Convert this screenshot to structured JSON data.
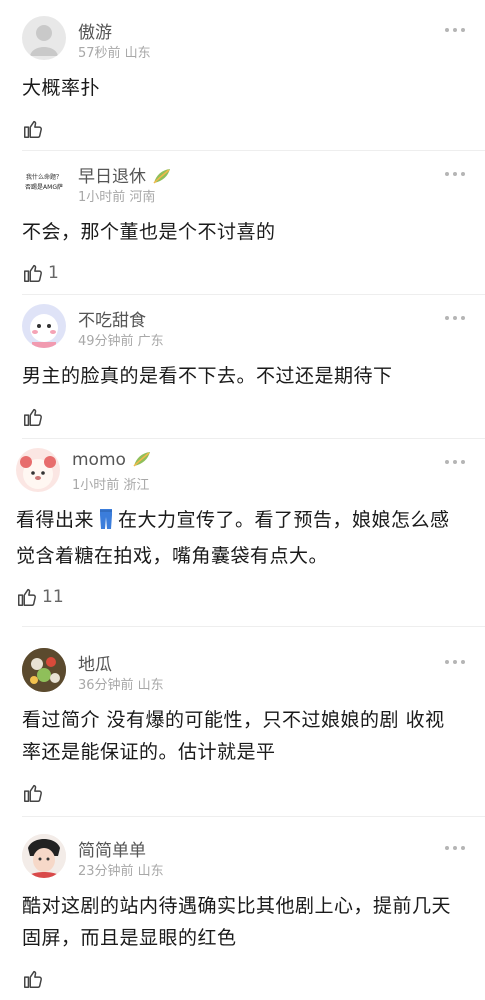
{
  "comments": [
    {
      "username": "傲游",
      "meta": "57秒前 山东",
      "text": "大概率扑",
      "likes": "",
      "badge": false,
      "avatar": "default-avatar"
    },
    {
      "username": "早日退休",
      "meta": "1小时前 河南",
      "text": "不会，那个董也是个不讨喜的",
      "likes": "1",
      "badge": true,
      "avatar": "text-avatar",
      "avatar_text_1": "我什么命题？",
      "avatar_text_2": "否踢是AMG萨"
    },
    {
      "username": "不吃甜食",
      "meta": "49分钟前 广东",
      "text": "男主的脸真的是看不下去。不过还是期待下",
      "likes": "",
      "badge": false,
      "avatar": "cartoon-avatar"
    },
    {
      "username": "momo",
      "meta": "1小时前 浙江",
      "text_before": "看得出来",
      "text_after": "在大力宣传了。看了预告，娘娘怎么感觉含着糖在拍戏，嘴角囊袋有点大。",
      "likes": "11",
      "badge": true,
      "avatar": "bear-avatar",
      "inline_icon": "jeans-emoji"
    },
    {
      "username": "地瓜",
      "meta": "36分钟前 山东",
      "text": "看过简介 没有爆的可能性，只不过娘娘的剧 收视率还是能保证的。估计就是平",
      "likes": "",
      "badge": false,
      "avatar": "food-avatar"
    },
    {
      "username": "简简单单",
      "meta": "23分钟前 山东",
      "text": "酷对这剧的站内待遇确实比其他剧上心，提前几天固屏，而且是显眼的红色",
      "likes": "",
      "badge": false,
      "avatar": "photo-avatar"
    }
  ],
  "icons": {
    "like": "thumbs-up-icon",
    "more": "more-dots-icon",
    "badge": "leaf-badge-icon"
  },
  "colors": {
    "name": "#555555",
    "meta": "#a8a8a8",
    "text": "#1a1a1a",
    "divider": "#eeeeee"
  }
}
